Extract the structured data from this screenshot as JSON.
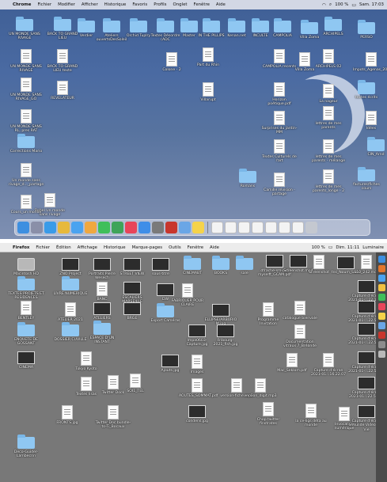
{
  "top": {
    "menubar": {
      "apple": "",
      "items": [
        "Chrome",
        "Fichier",
        "Modifier",
        "Afficher",
        "Historique",
        "Favoris",
        "Profils",
        "Onglet",
        "Fenêtre",
        "Aide"
      ],
      "battery": "100 %",
      "clock": "Sam. 17:03"
    },
    "icons": [
      {
        "kind": "folder",
        "label": "UN MONDE SANS RIVAGE"
      },
      {
        "kind": "folder",
        "label": "BACK TO GRAND LIEU"
      },
      {
        "kind": "folder",
        "label": "Verdier"
      },
      {
        "kind": "folder",
        "label": "Ateliers ouvertsDesSoleil"
      },
      {
        "kind": "folder",
        "label": "Orchid Tuplry"
      },
      {
        "kind": "folder",
        "label": "Textes Désordre (ADC"
      },
      {
        "kind": "folder",
        "label": "Master"
      },
      {
        "kind": "folder",
        "label": "IN THE PILLIPS"
      },
      {
        "kind": "folder",
        "label": "Kenan.net"
      },
      {
        "kind": "folder",
        "label": "INCULTE"
      },
      {
        "kind": "folder",
        "label": "CAMPOLIA"
      },
      {
        "kind": "folder",
        "label": "Villa Zoma"
      },
      {
        "kind": "folder",
        "label": "ARCHIPELS"
      },
      {
        "kind": "folder",
        "label": "PERSO"
      },
      {
        "kind": "doc",
        "label": "UN MONDE SANS RIVAGE"
      },
      {
        "kind": "doc",
        "label": "BACK TO GRAND LIEU texte"
      },
      {
        "kind": "doc",
        "label": "Colone - 2"
      },
      {
        "kind": "doc",
        "label": "Part du Rhin"
      },
      {
        "kind": "doc",
        "label": "CAMPOLIA recents"
      },
      {
        "kind": "doc",
        "label": "Villa Zoma"
      },
      {
        "kind": "doc",
        "label": "ARCHIPELS 02"
      },
      {
        "kind": "doc",
        "label": "Impots_Agenas_2020_BET_com_a(2025)"
      },
      {
        "kind": "doc",
        "label": "UN MONDE SANS RIVAGE_GO"
      },
      {
        "kind": "doc",
        "label": "REVELATEUR"
      },
      {
        "kind": "doc",
        "label": "Villarupt"
      },
      {
        "kind": "doc",
        "label": "Horizon poétique.pdf"
      },
      {
        "kind": "doc",
        "label": "La nageur"
      },
      {
        "kind": "folder",
        "label": "textes écrits"
      },
      {
        "kind": "doc",
        "label": "UN MONDE SANS RL, pres RAT"
      },
      {
        "kind": "doc",
        "label": "Surprises du jardin-MM"
      },
      {
        "kind": "doc",
        "label": "lettres de mes parents"
      },
      {
        "kind": "doc",
        "label": "Idées"
      },
      {
        "kind": "folder",
        "label": "Corrections Mario"
      },
      {
        "kind": "doc",
        "label": "Textes Culturels de l'art"
      },
      {
        "kind": "doc",
        "label": "lettres de mes parents - mélange"
      },
      {
        "kind": "folder",
        "label": "CIN_Arnd"
      },
      {
        "kind": "doc",
        "label": "Un monde sans rivage_d..._partage"
      },
      {
        "kind": "folder",
        "label": "Romans"
      },
      {
        "kind": "doc",
        "label": "Camille révision - partage"
      },
      {
        "kind": "doc",
        "label": "lettres de mes parents_longe - 2"
      },
      {
        "kind": "folder",
        "label": "factures/fiches cours"
      },
      {
        "kind": "doc",
        "label": "Rebel Un monde sans rivage"
      },
      {
        "kind": "doc",
        "label": "Cours_un monde"
      }
    ],
    "dock": [
      "finder",
      "launchpad",
      "safari",
      "chrome",
      "mail",
      "photos",
      "messages",
      "facetime",
      "music",
      "app-store",
      "settings",
      "acrobat",
      "preview",
      "notes",
      "doc",
      "doc",
      "doc",
      "doc",
      "doc",
      "doc",
      "doc",
      "trash"
    ]
  },
  "bottom": {
    "menubar": {
      "apple": "",
      "items": [
        "Firefox",
        "Fichier",
        "Édition",
        "Affichage",
        "Historique",
        "Marque-pages",
        "Outils",
        "Fenêtre",
        "Aide"
      ],
      "battery": "100 %",
      "clock": "Dim. 11:11",
      "extra": "Luminaire"
    },
    "icons": [
      {
        "kind": "disk",
        "label": "Macintosh HD"
      },
      {
        "kind": "img",
        "label": "ZNO Project"
      },
      {
        "kind": "img",
        "label": "Portraits Pierre Wesech"
      },
      {
        "kind": "img",
        "label": "STREET VIEW"
      },
      {
        "kind": "img",
        "label": "sous-titre"
      },
      {
        "kind": "folder",
        "label": "CINEMABT"
      },
      {
        "kind": "folder",
        "label": "BOOKS"
      },
      {
        "kind": "folder",
        "label": "sale"
      },
      {
        "kind": "img",
        "label": "dfrache-sm-pdf myselft_GCAM.pdf"
      },
      {
        "kind": "img",
        "label": "Screenshot.mp4"
      },
      {
        "kind": "doc",
        "label": "Screenshot"
      },
      {
        "kind": "img",
        "label": "tns_Noum_Sans"
      },
      {
        "kind": "doc",
        "label": "S10_242.mov"
      },
      {
        "kind": "folder",
        "label": "TEXTES PROJETS ET RESIDENCES"
      },
      {
        "kind": "folder",
        "label": "LIVRE NUMERIQUE"
      },
      {
        "kind": "doc",
        "label": "BANC"
      },
      {
        "kind": "img",
        "label": "ESCALIERS MARSEILLE"
      },
      {
        "kind": "img",
        "label": "DW"
      },
      {
        "kind": "doc",
        "label": "FABRIQUER POUR CLAIRE"
      },
      {
        "kind": "img",
        "label": "Capture d'écran 2021-01-...22.10.43"
      },
      {
        "kind": "doc",
        "label": "BENTLEY"
      },
      {
        "kind": "doc",
        "label": "ATELIER 2021"
      },
      {
        "kind": "img",
        "label": "ATELIERS"
      },
      {
        "kind": "img",
        "label": "BRGE"
      },
      {
        "kind": "folder",
        "label": "Export Caméras"
      },
      {
        "kind": "img",
        "label": "ELLIPSE/ARBURIO M.jpg"
      },
      {
        "kind": "doc",
        "label": "Programme Invitation"
      },
      {
        "kind": "doc",
        "label": "catalogue bienvale"
      },
      {
        "kind": "img",
        "label": "Capture d'écran 2021-01-...22.52.58"
      },
      {
        "kind": "folder",
        "label": "ENQUETE DE GOSSANT"
      },
      {
        "kind": "folder",
        "label": "DOSSIER CUVILLE"
      },
      {
        "kind": "folder",
        "label": "ESPACE D'UN INSTANT"
      },
      {
        "kind": "img",
        "label": "Impa0603-Capture.jpg"
      },
      {
        "kind": "img",
        "label": "Fribourg-2021_fish.jpg"
      },
      {
        "kind": "doc",
        "label": "Documentation vitraux 7_Bréande"
      },
      {
        "kind": "img",
        "label": "Capture d'écran 2021-01-...22.55.57"
      },
      {
        "kind": "img",
        "label": "CINEMA"
      },
      {
        "kind": "doc",
        "label": "Tokyo Kyoto"
      },
      {
        "kind": "img",
        "label": "Ajouts.jpg"
      },
      {
        "kind": "doc",
        "label": "Images"
      },
      {
        "kind": "doc",
        "label": "Mac_Seklom.pdf"
      },
      {
        "kind": "doc",
        "label": "Capture d'écran 2021-01...16.22.07"
      },
      {
        "kind": "img",
        "label": "Capture d'écran 2021-01-...22.52.11"
      },
      {
        "kind": "doc",
        "label": "Textes lisas"
      },
      {
        "kind": "doc",
        "label": "Twitter Dock"
      },
      {
        "kind": "doc",
        "label": "SOI1_TEL"
      },
      {
        "kind": "doc",
        "label": "AOUTES_SOMMAT.pdf"
      },
      {
        "kind": "doc",
        "label": "version-fiche.mp3"
      },
      {
        "kind": "doc",
        "label": "version_digit.mp3"
      },
      {
        "kind": "img",
        "label": "Capture d'écran 2021-01...22.53.18"
      },
      {
        "kind": "doc",
        "label": "FRONTS.jpg"
      },
      {
        "kind": "doc",
        "label": "Twitter Doc bundle-to-Ti_Bocaux"
      },
      {
        "kind": "img",
        "label": "condens.jpg"
      },
      {
        "kind": "doc",
        "label": "Chop twitter finstrates"
      },
      {
        "kind": "doc",
        "label": "la ce-ligs déta au monde"
      },
      {
        "kind": "doc",
        "label": "Invocation numérique"
      },
      {
        "kind": "img",
        "label": "Capture d'écran Simulide Video Mac Vie"
      },
      {
        "kind": "folder",
        "label": "Deco-Guider-Lambecrin"
      }
    ]
  }
}
